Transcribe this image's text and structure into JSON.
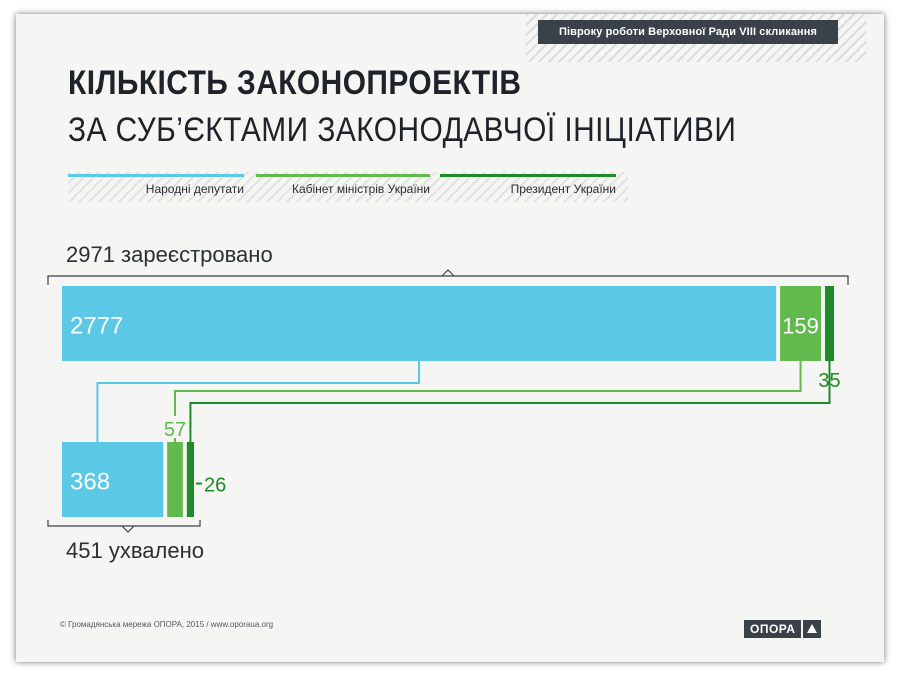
{
  "header": {
    "badge": "Півроку роботи Верховної Ради VIII скликання",
    "title_line1": "КІЛЬКІСТЬ ЗАКОНОПРОЕКТІВ",
    "title_line2": "ЗА СУБ’ЄКТАМИ ЗАКОНОДАВЧОЇ ІНІЦІАТИВИ"
  },
  "colors": {
    "mps": "#5bc8e6",
    "cabinet": "#62b94e",
    "president": "#1f8a2a",
    "text": "#2b2f36"
  },
  "footer": {
    "copyright": "© Громадянська мережа ОПОРА, 2015 / www.oporaua.org",
    "logo_text": "ОПОРА"
  },
  "chart_data": {
    "type": "bar",
    "orientation": "horizontal-stacked",
    "categories": [
      "registered",
      "adopted"
    ],
    "series": [
      {
        "name": "Народні депутати",
        "values": [
          2777,
          368
        ]
      },
      {
        "name": "Кабінет міністрів України",
        "values": [
          159,
          57
        ]
      },
      {
        "name": "Президент України",
        "values": [
          35,
          26
        ]
      }
    ],
    "totals": [
      2971,
      451
    ],
    "total_labels": [
      "2971 зареєстровано",
      "451 ухвалено"
    ],
    "legend": "top"
  }
}
